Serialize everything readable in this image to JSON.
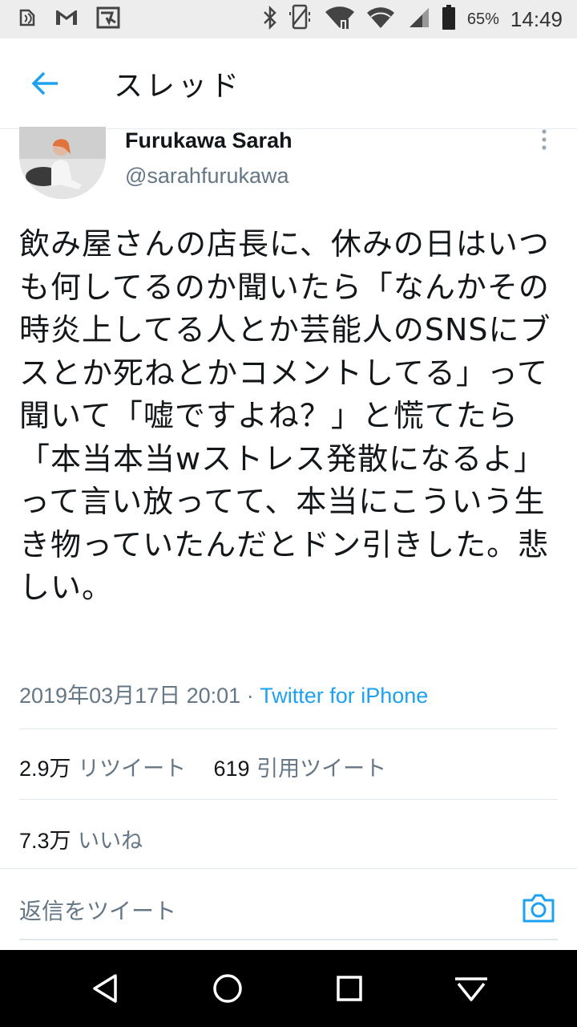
{
  "status_bar": {
    "battery_percent": "65%",
    "time": "14:49",
    "icons": [
      "nfc-icon",
      "gmail-icon",
      "store-icon",
      "bluetooth-icon",
      "vibrate-icon",
      "wifi-calling-icon",
      "wifi-icon",
      "signal-icon",
      "battery-icon"
    ]
  },
  "header": {
    "title": "スレッド",
    "back_icon": "arrow-left-icon"
  },
  "tweet": {
    "display_name": "Furukawa Sarah",
    "handle": "@sarahfurukawa",
    "text": "飲み屋さんの店長に、休みの日はいつも何してるのか聞いたら「なんかその時炎上してる人とか芸能人のSNSにブスとか死ねとかコメントしてる」って聞いて「嘘ですよね？」と慌てたら「本当本当wストレス発散になるよ」って言い放ってて、本当にこういう生き物っていたんだとドン引きした。悲しい。",
    "timestamp": "2019年03月17日 20:01 · ",
    "source": "Twitter for iPhone",
    "retweets_count": "2.9万",
    "retweets_label": "リツイート",
    "quotes_count": "619",
    "quotes_label": "引用ツイート",
    "likes_count": "7.3万",
    "likes_label": "いいね"
  },
  "composer": {
    "placeholder": "返信をツイート",
    "camera_icon": "camera-icon"
  },
  "accent_color": "#1da1f2",
  "nav_bar": {
    "icons": [
      "back-triangle-icon",
      "home-circle-icon",
      "recents-square-icon",
      "keyboard-hide-icon"
    ]
  }
}
